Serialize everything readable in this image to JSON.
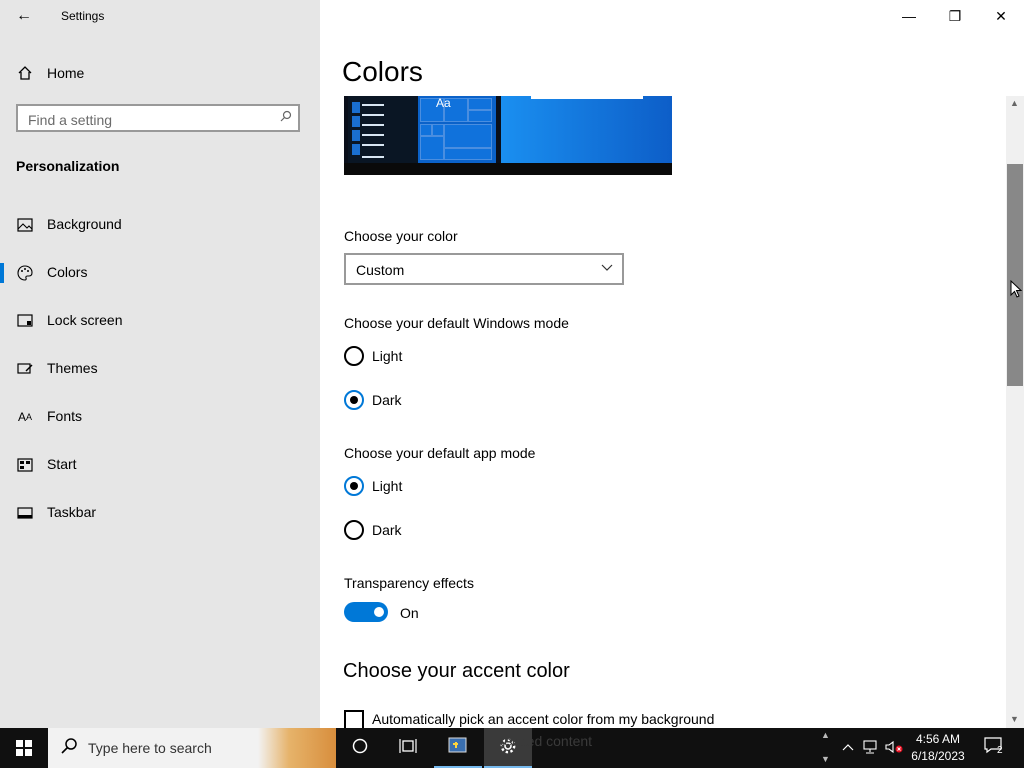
{
  "window": {
    "app_title": "Settings",
    "back_icon": "back-arrow-icon",
    "controls": [
      "minimize-icon",
      "restore-icon",
      "close-icon"
    ]
  },
  "sidebar": {
    "home_label": "Home",
    "search_placeholder": "Find a setting",
    "section_title": "Personalization",
    "items": [
      {
        "label": "Background",
        "icon": "picture-icon"
      },
      {
        "label": "Colors",
        "icon": "palette-icon",
        "selected": true
      },
      {
        "label": "Lock screen",
        "icon": "lock-screen-icon"
      },
      {
        "label": "Themes",
        "icon": "brush-icon"
      },
      {
        "label": "Fonts",
        "icon": "font-icon"
      },
      {
        "label": "Start",
        "icon": "start-icon"
      },
      {
        "label": "Taskbar",
        "icon": "taskbar-icon"
      }
    ]
  },
  "main": {
    "title": "Colors",
    "preview_label": "Aa",
    "choose_color_label": "Choose your color",
    "choose_color_value": "Custom",
    "windows_mode_label": "Choose your default Windows mode",
    "windows_mode_options": [
      {
        "label": "Light",
        "checked": false
      },
      {
        "label": "Dark",
        "checked": true
      }
    ],
    "app_mode_label": "Choose your default app mode",
    "app_mode_options": [
      {
        "label": "Light",
        "checked": true
      },
      {
        "label": "Dark",
        "checked": false
      }
    ],
    "transparency_label": "Transparency effects",
    "transparency_state": "On",
    "accent_heading": "Choose your accent color",
    "auto_accent_label": "Automatically pick an accent color from my background",
    "auto_accent_checked": false
  },
  "taskbar": {
    "search_placeholder": "Type here to search",
    "ghost_text": "Related content",
    "time": "4:56 AM",
    "date": "6/18/2023",
    "notification_count": "2"
  },
  "colors": {
    "accent": "#0078d7",
    "sidebar_bg": "#e6e6e6",
    "taskbar_bg": "#101010"
  }
}
